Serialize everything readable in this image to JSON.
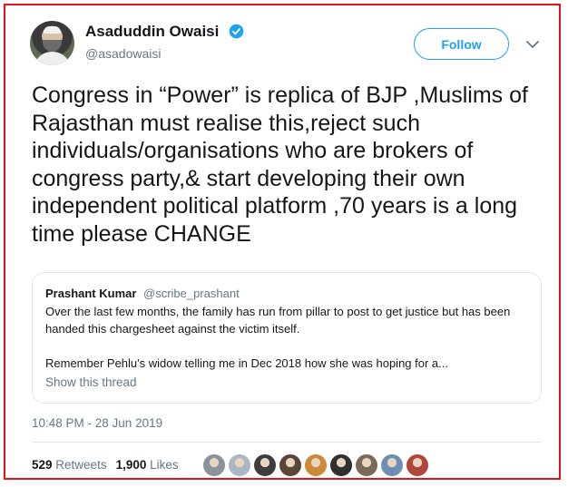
{
  "author": {
    "name": "Asaduddin Owaisi",
    "handle": "@asadowaisi",
    "verified_icon": "verified-badge-icon"
  },
  "follow_button": {
    "label": "Follow"
  },
  "tweet": {
    "text": "Congress in “Power” is replica of BJP ,Muslims of Rajasthan must realise this,reject such individuals/organisations who are brokers of congress party,& start developing their own independent political platform ,70 years is a long time please CHANGE"
  },
  "quoted_tweet": {
    "name": "Prashant Kumar",
    "handle": "@scribe_prashant",
    "paragraph_1": "Over the last few months, the family has run from pillar to post to get justice but has been handed this chargesheet against the victim itself.",
    "paragraph_2": "Remember Pehlu's widow telling me in Dec 2018 how she was hoping for a...",
    "show_thread": "Show this thread"
  },
  "timestamp": "10:48 PM - 28 Jun 2019",
  "stats": {
    "retweets_count": "529",
    "retweets_label": "Retweets",
    "likes_count": "1,900",
    "likes_label": "Likes"
  },
  "likers": [
    {
      "name": "liker-avatar-1",
      "color": "#8a929b"
    },
    {
      "name": "liker-avatar-2",
      "color": "#a9b8c4"
    },
    {
      "name": "liker-avatar-3",
      "color": "#3d3d3d"
    },
    {
      "name": "liker-avatar-4",
      "color": "#5a4636"
    },
    {
      "name": "liker-avatar-5",
      "color": "#c98a3a"
    },
    {
      "name": "liker-avatar-6",
      "color": "#2f2f2f"
    },
    {
      "name": "liker-avatar-7",
      "color": "#7b6a58"
    },
    {
      "name": "liker-avatar-8",
      "color": "#6d8fb3"
    },
    {
      "name": "liker-avatar-9",
      "color": "#b0473c"
    }
  ],
  "colors": {
    "accent": "#1da1f2",
    "border_highlight": "#e0131b",
    "secondary_text": "#657786"
  }
}
